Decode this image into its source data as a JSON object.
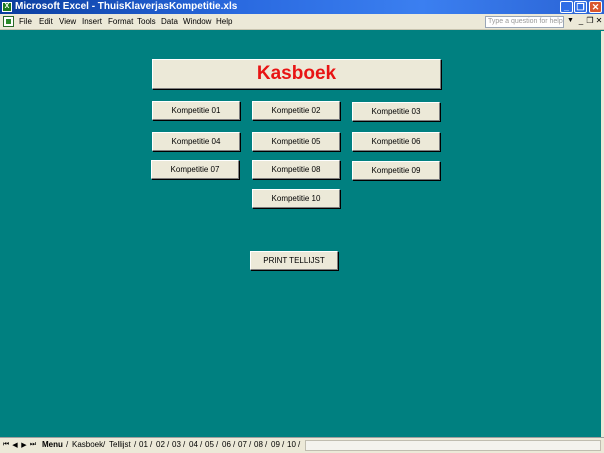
{
  "window": {
    "title": "Microsoft Excel - ThuisKlaverjasKompetitie.xls",
    "app_icon": "excel-icon",
    "controls": [
      "minimize",
      "restore",
      "close"
    ]
  },
  "menubar": {
    "items": [
      "File",
      "Edit",
      "View",
      "Insert",
      "Format",
      "Tools",
      "Data",
      "Window",
      "Help"
    ],
    "help_placeholder": "Type a question for help"
  },
  "sheet": {
    "title": "Kasboek",
    "buttons": [
      "Kompetitie 01",
      "Kompetitie 02",
      "Kompetitie 03",
      "Kompetitie 04",
      "Kompetitie 05",
      "Kompetitie 06",
      "Kompetitie 07",
      "Kompetitie 08",
      "Kompetitie 09",
      "Kompetitie 10"
    ],
    "print_button": "PRINT TELLIJST",
    "title_color": "#e81414",
    "background_color": "#008080"
  },
  "tabs": {
    "items": [
      "Menu",
      "Kasboek",
      "Tellijst",
      "01",
      "02",
      "03",
      "04",
      "05",
      "06",
      "07",
      "08",
      "09",
      "10"
    ],
    "active": "Menu"
  }
}
